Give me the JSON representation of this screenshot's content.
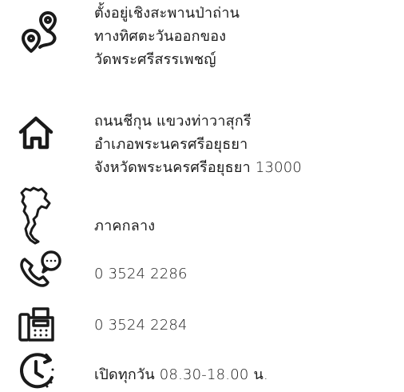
{
  "location": {
    "icon": "map-route-pin-icon",
    "lines": [
      "ตั้งอยู่เชิงสะพานป่าถ่าน",
      "ทางทิศตะวันออกของ",
      "วัดพระศรีสรรเพชญ์"
    ]
  },
  "address": {
    "icon": "home-icon",
    "lines": [
      "ถนนชีกุน แขวงท่าวาสุกรี",
      "อำเภอพระนครศรีอยุธยา",
      "จังหวัดพระนครศรีอยุธยา 13000"
    ]
  },
  "region": {
    "icon": "thailand-map-icon",
    "text": "ภาคกลาง"
  },
  "phone": {
    "icon": "phone-chat-icon",
    "text": "0 3524 2286"
  },
  "fax": {
    "icon": "fax-machine-icon",
    "text": "0 3524 2284"
  },
  "hours": {
    "icon": "clock-icon",
    "text": "เปิดทุกวัน 08.30-18.00 น."
  }
}
